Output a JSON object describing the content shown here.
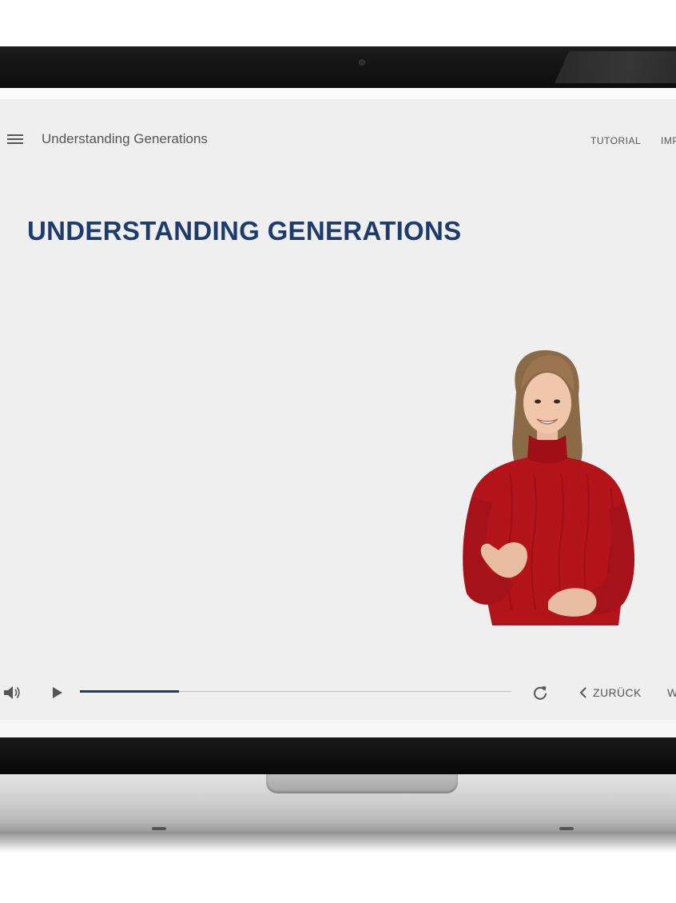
{
  "app": {
    "title": "Understanding Generations",
    "nav": [
      {
        "label": "TUTORIAL"
      },
      {
        "label": "IMPRESSUM"
      }
    ]
  },
  "slide": {
    "heading": "UNDERSTANDING GENERATIONS",
    "signer_image": "sign-language-interpreter"
  },
  "player": {
    "progress": 0.23,
    "back_label": "ZURÜCK",
    "next_label": "WEITER",
    "icons": [
      "volume-icon",
      "play-icon",
      "replay-icon",
      "chevron-left-icon"
    ]
  },
  "colors": {
    "accent": "#1e3b6e",
    "screen_bg": "#efefef",
    "text": "#555555",
    "signer_sweater": "#b3141a"
  }
}
